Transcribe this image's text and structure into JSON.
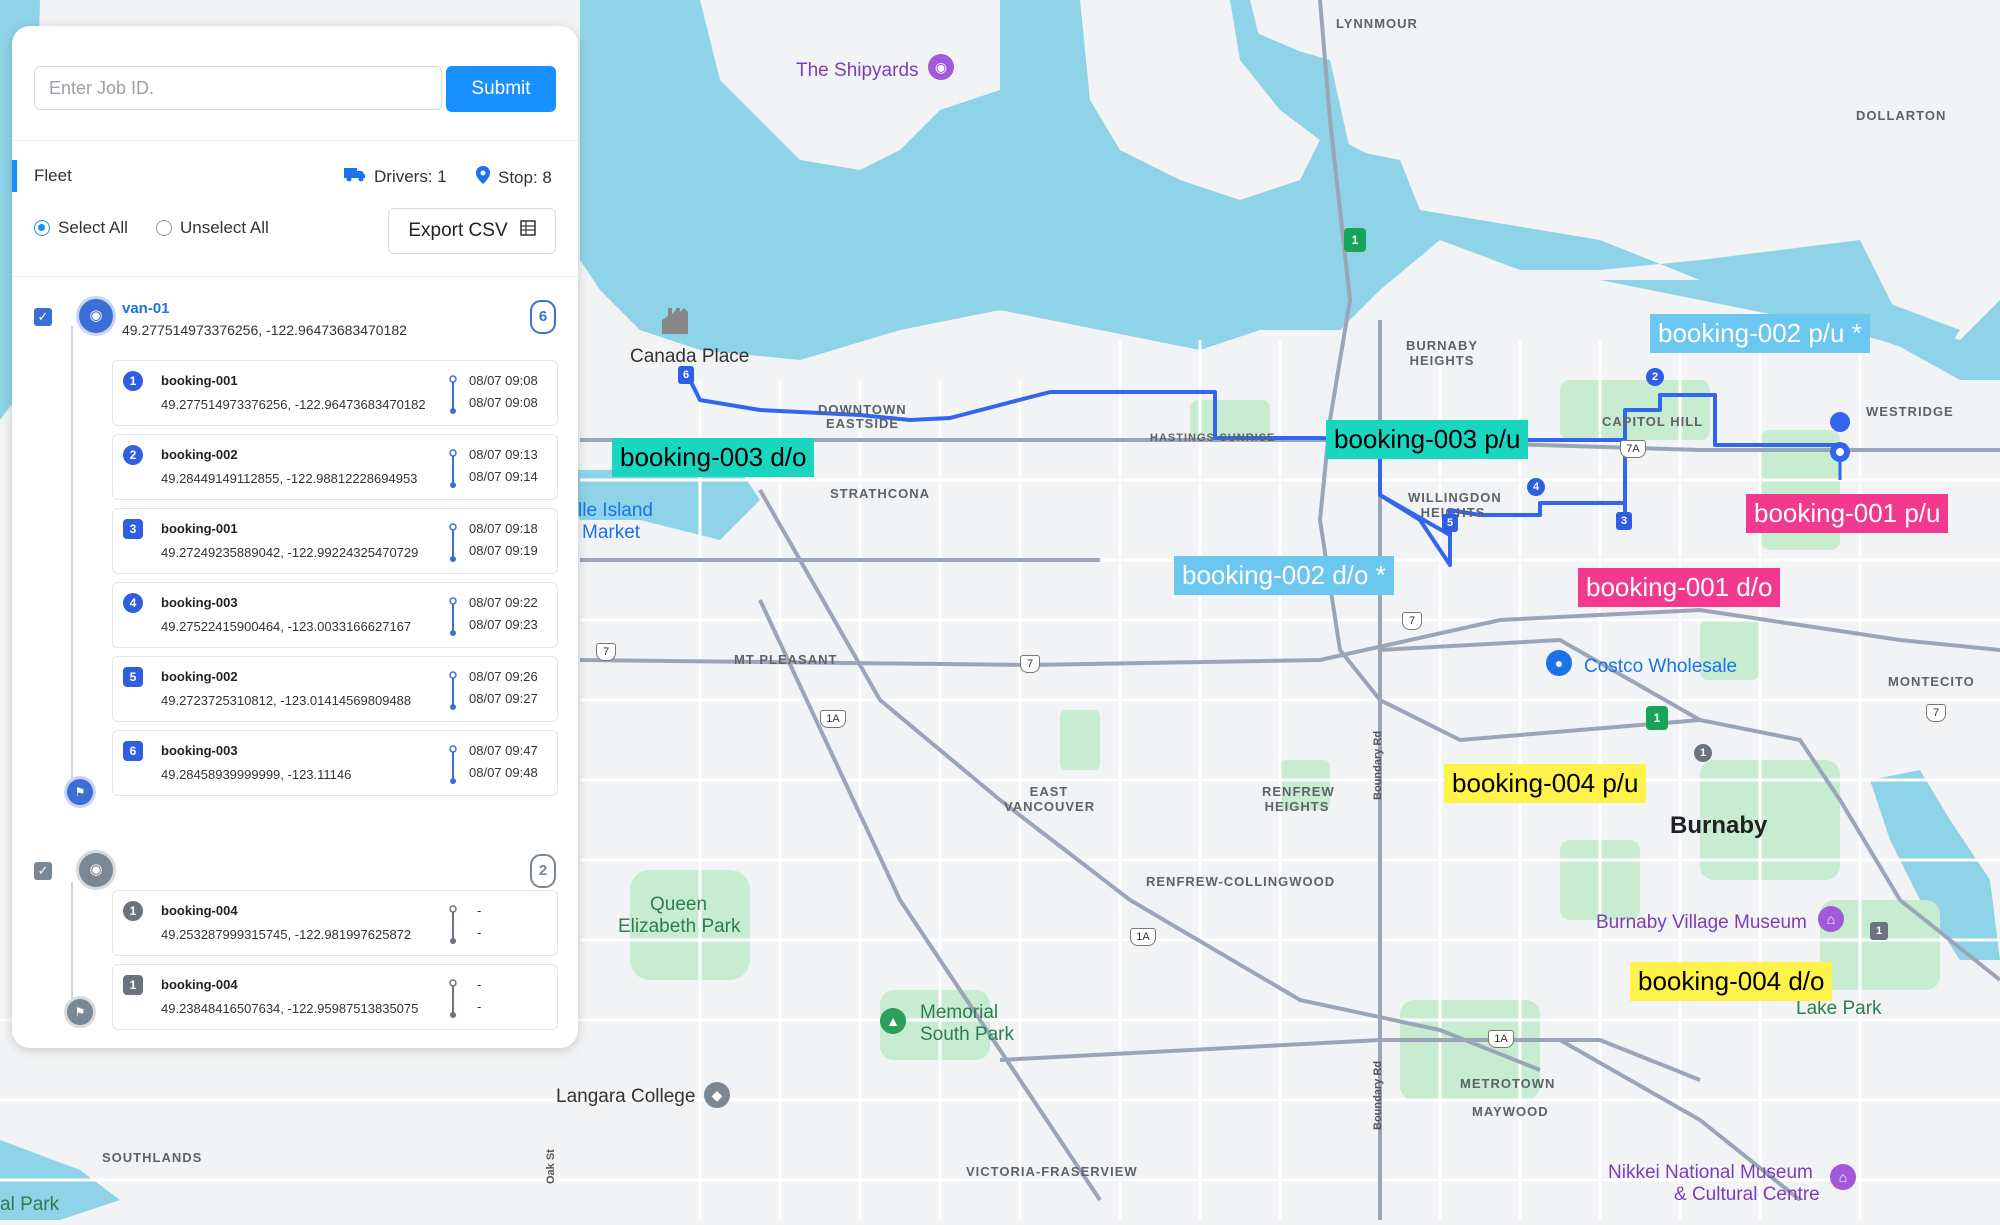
{
  "map": {
    "area_labels": [
      "LYNNMOUR",
      "DOLLARTON",
      "BURNABY HEIGHTS",
      "CAPITOL HILL",
      "WESTRIDGE",
      "DOWNTOWN",
      "EASTSIDE",
      "STRATHCONA",
      "WILLINGDON HEIGHTS",
      "MT PLEASANT",
      "MONTECITO",
      "EAST VANCOUVER",
      "RENFREW HEIGHTS",
      "RENFREW-COLLINGWOOD",
      "METROTOWN",
      "MAYWOOD",
      "SOUTHLANDS",
      "VICTORIA-FRASERVIEW",
      "HASTINGS-SUNRISE"
    ],
    "city_label": "Burnaby",
    "pois": {
      "shipyards": "The Shipyards",
      "canada_place": "Canada Place",
      "granville_island_a": "lle Island",
      "granville_island_b": "Market",
      "costco": "Costco Wholesale",
      "burnaby_village": "Burnaby Village Museum",
      "memorial_park_a": "Memorial",
      "memorial_park_b": "South Park",
      "queen_elizabeth_a": "Queen",
      "queen_elizabeth_b": "Elizabeth Park",
      "langara": "Langara College",
      "lake_park": "Lake Park",
      "nikkei_a": "Nikkei National Museum",
      "nikkei_b": "& Cultural Centre",
      "edge_park": "al Park",
      "boundary_rd": "Boundary Rd",
      "oak_st": "Oak St"
    },
    "highway_signs": [
      "1",
      "7",
      "7",
      "7",
      "1A",
      "1A",
      "1A",
      "7A",
      "7",
      "1"
    ],
    "route_stops": [
      "1",
      "2",
      "3",
      "4",
      "5",
      "6"
    ],
    "gray_stops": [
      "1",
      "1"
    ],
    "annotations": [
      {
        "text": "booking-003 d/o",
        "style": "teal"
      },
      {
        "text": "booking-003 p/u",
        "style": "teal"
      },
      {
        "text": "booking-002 p/u *",
        "style": "sky"
      },
      {
        "text": "booking-002 d/o *",
        "style": "sky"
      },
      {
        "text": "booking-001 p/u",
        "style": "pink"
      },
      {
        "text": "booking-001 d/o",
        "style": "pink"
      },
      {
        "text": "booking-004 p/u",
        "style": "yellow"
      },
      {
        "text": "booking-004 d/o",
        "style": "yellow"
      }
    ],
    "colors": {
      "water": "#8fd3e8",
      "land": "#f1f3f4",
      "park": "#c8ecd0",
      "route": "#3366ee",
      "road": "#ffffff",
      "major_road": "#9aa6b8"
    }
  },
  "panel": {
    "job_input_placeholder": "Enter Job ID.",
    "submit_label": "Submit",
    "fleet_label": "Fleet",
    "drivers_label": "Drivers: 1",
    "stops_label": "Stop: 8",
    "select_all_label": "Select All",
    "unselect_all_label": "Unselect All",
    "export_label": "Export CSV",
    "vehicles": [
      {
        "name": "van-01",
        "coords": "49.277514973376256, -122.96473683470182",
        "count": "6",
        "stops": [
          {
            "num": "1",
            "name": "booking-001",
            "coords": "49.277514973376256, -122.96473683470182",
            "t1": "08/07 09:08",
            "t2": "08/07 09:08"
          },
          {
            "num": "2",
            "name": "booking-002",
            "coords": "49.28449149112855, -122.98812228694953",
            "t1": "08/07 09:13",
            "t2": "08/07 09:14"
          },
          {
            "num": "3",
            "name": "booking-001",
            "coords": "49.27249235889042, -122.99224325470729",
            "t1": "08/07 09:18",
            "t2": "08/07 09:19"
          },
          {
            "num": "4",
            "name": "booking-003",
            "coords": "49.27522415900464, -123.0033166627167",
            "t1": "08/07 09:22",
            "t2": "08/07 09:23"
          },
          {
            "num": "5",
            "name": "booking-002",
            "coords": "49.2723725310812, -123.01414569809488",
            "t1": "08/07 09:26",
            "t2": "08/07 09:27"
          },
          {
            "num": "6",
            "name": "booking-003",
            "coords": "49.28458939999999, -123.11146",
            "t1": "08/07 09:47",
            "t2": "08/07 09:48"
          }
        ]
      },
      {
        "name": "",
        "coords": "",
        "count": "2",
        "stops": [
          {
            "num": "1",
            "name": "booking-004",
            "coords": "49.253287999315745, -122.981997625872",
            "t1": "-",
            "t2": "-"
          },
          {
            "num": "1",
            "name": "booking-004",
            "coords": "49.23848416507634, -122.95987513835075",
            "t1": "-",
            "t2": "-"
          }
        ]
      }
    ]
  }
}
